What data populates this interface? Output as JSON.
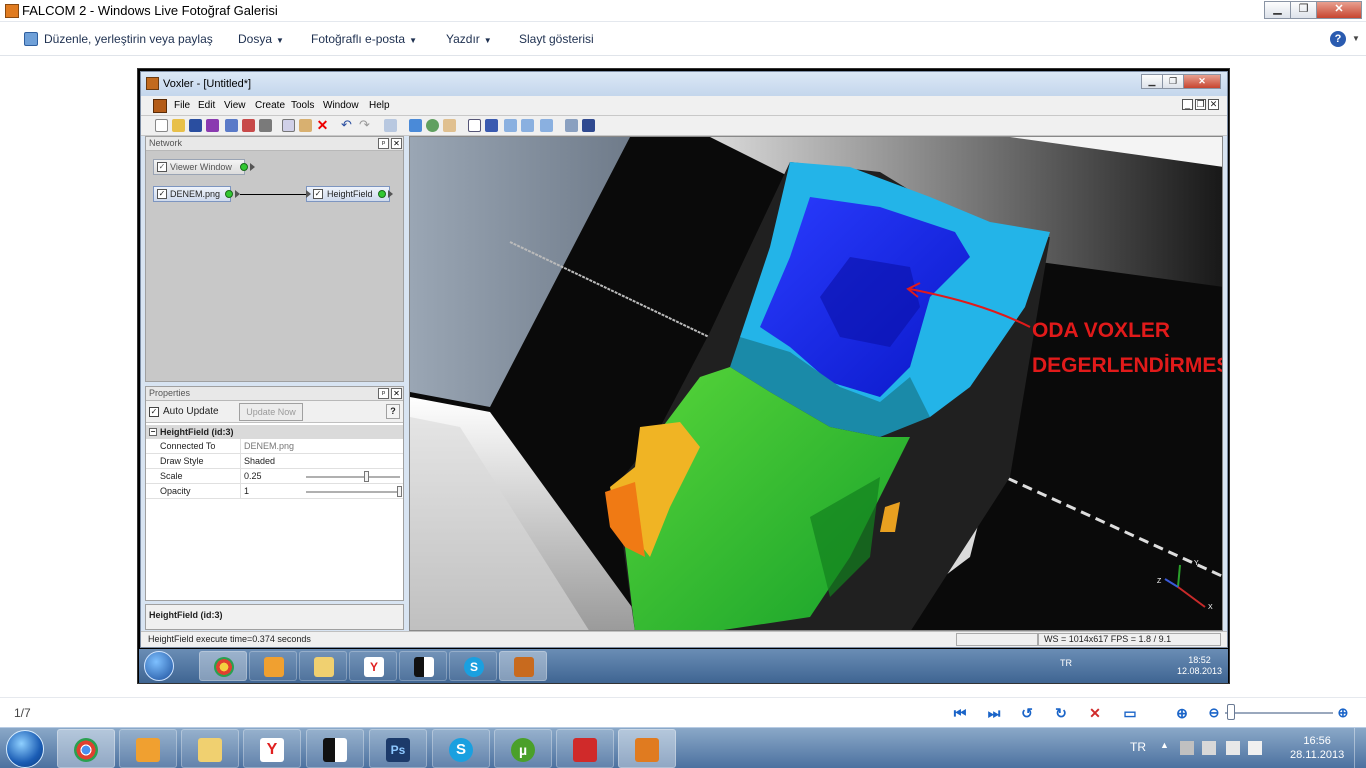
{
  "gallery": {
    "title": "FALCOM 2 - Windows Live Fotoğraf Galerisi",
    "menu": {
      "share": "Düzenle, yerleştirin veya paylaş",
      "file": "Dosya",
      "email": "Fotoğraflı e-posta",
      "print": "Yazdır",
      "slideshow": "Slayt gösterisi",
      "help": "?"
    },
    "nav": {
      "counter": "1/7"
    }
  },
  "voxler": {
    "title": "Voxler - [Untitled*]",
    "menu": [
      "File",
      "Edit",
      "View",
      "Create",
      "Tools",
      "Window",
      "Help"
    ],
    "network": {
      "header": "Network",
      "nodes": {
        "viewer": "Viewer Window",
        "denem": "DENEM.png",
        "heightfield": "HeightField"
      }
    },
    "properties": {
      "header": "Properties",
      "auto_update": "Auto Update",
      "update_now": "Update Now",
      "help_btn": "?",
      "group": "HeightField (id:3)",
      "rows": [
        {
          "key": "Connected To",
          "value": "DENEM.png"
        },
        {
          "key": "Draw Style",
          "value": "Shaded"
        },
        {
          "key": "Scale",
          "value": "0.25"
        },
        {
          "key": "Opacity",
          "value": "1"
        }
      ],
      "help_title": "HeightField (id:3)"
    },
    "status": {
      "left": "HeightField execute time=0.374 seconds",
      "right": "WS = 1014x617  FPS = 1.8 / 9.1"
    },
    "viewer_annotation": {
      "line1": "ODA VOXLER",
      "line2": "DEGERLENDİRMESİ"
    },
    "axes": {
      "x": "X",
      "y": "Y",
      "z": "Z"
    }
  },
  "inner_tray": {
    "lang": "TR",
    "time": "18:52",
    "date": "12.08.2013"
  },
  "tray": {
    "lang": "TR",
    "time": "16:56",
    "date": "28.11.2013"
  },
  "colors": {
    "annotation_red": "#e11a1a",
    "surface_blue": "#1a2bff",
    "surface_cyan": "#1fb4e0",
    "surface_green": "#2fc42f",
    "surface_orange": "#f08a1a",
    "gallery_accent": "#1a64c8"
  }
}
